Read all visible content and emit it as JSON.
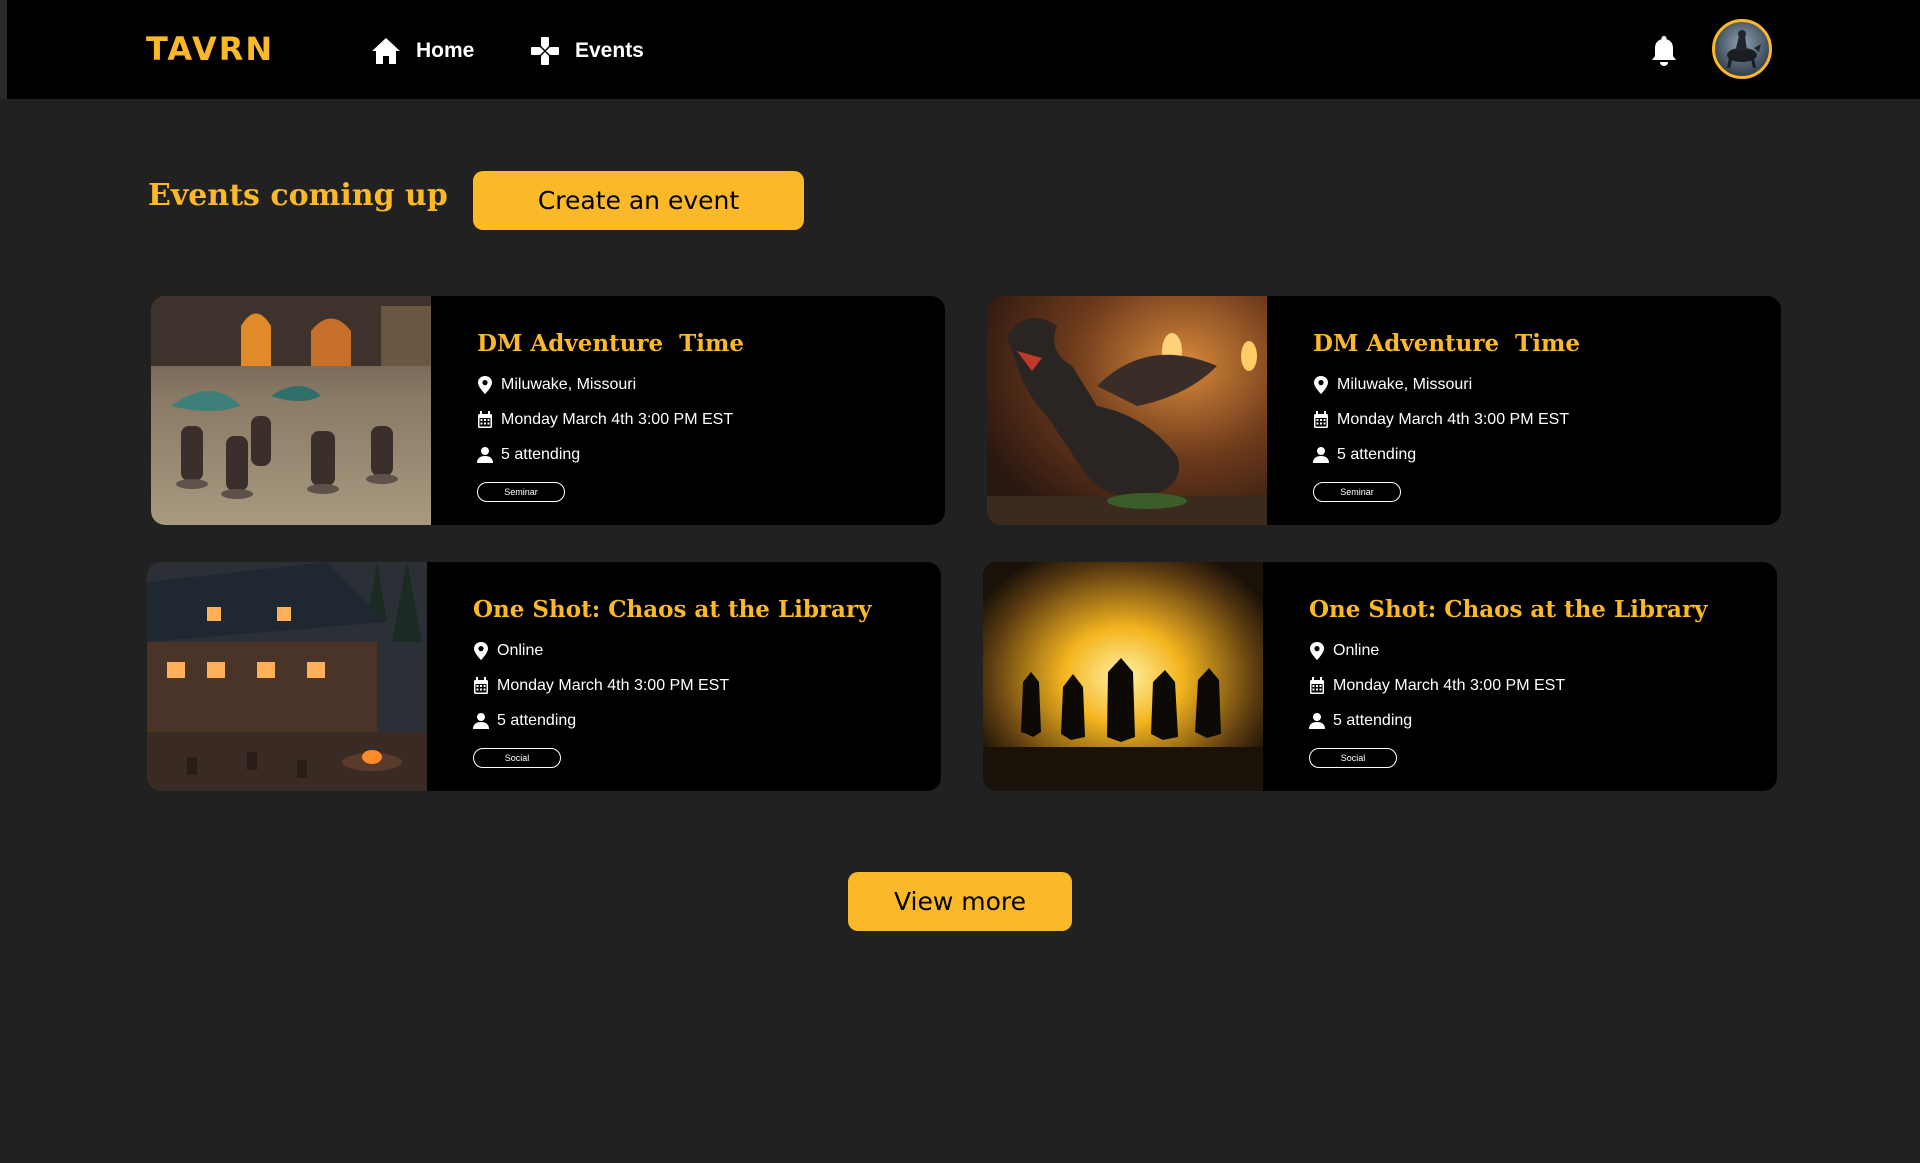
{
  "app": {
    "logo": "TAVRN",
    "nav": [
      {
        "label": "Home",
        "icon": "home-icon"
      },
      {
        "label": "Events",
        "icon": "gamepad-icon"
      }
    ],
    "notification_icon": "bell-icon",
    "avatar_icon": "user-avatar"
  },
  "colors": {
    "accent": "#fbb829",
    "background": "#212121",
    "topbar": "#000000",
    "card": "#000000"
  },
  "main": {
    "title": "Events coming up",
    "create_button": "Create an event",
    "view_more_button": "View more"
  },
  "events": [
    {
      "title": "DM Adventure  Time",
      "location": "Miluwake, Missouri",
      "date": "Monday March 4th 3:00 PM EST",
      "attending": "5 attending",
      "tag": "Seminar",
      "image": "miniatures-battle-image"
    },
    {
      "title": "DM Adventure  Time",
      "location": "Miluwake, Missouri",
      "date": "Monday March 4th 3:00 PM EST",
      "attending": "5 attending",
      "tag": "Seminar",
      "image": "dragon-miniature-image"
    },
    {
      "title": "One Shot: Chaos at the Library",
      "location": "Online",
      "date": "Monday March 4th 3:00 PM EST",
      "attending": "5 attending",
      "tag": "Social",
      "image": "tavern-night-image"
    },
    {
      "title": "One Shot: Chaos at the Library",
      "location": "Online",
      "date": "Monday March 4th 3:00 PM EST",
      "attending": "5 attending",
      "tag": "Social",
      "image": "heroes-silhouette-image"
    }
  ]
}
